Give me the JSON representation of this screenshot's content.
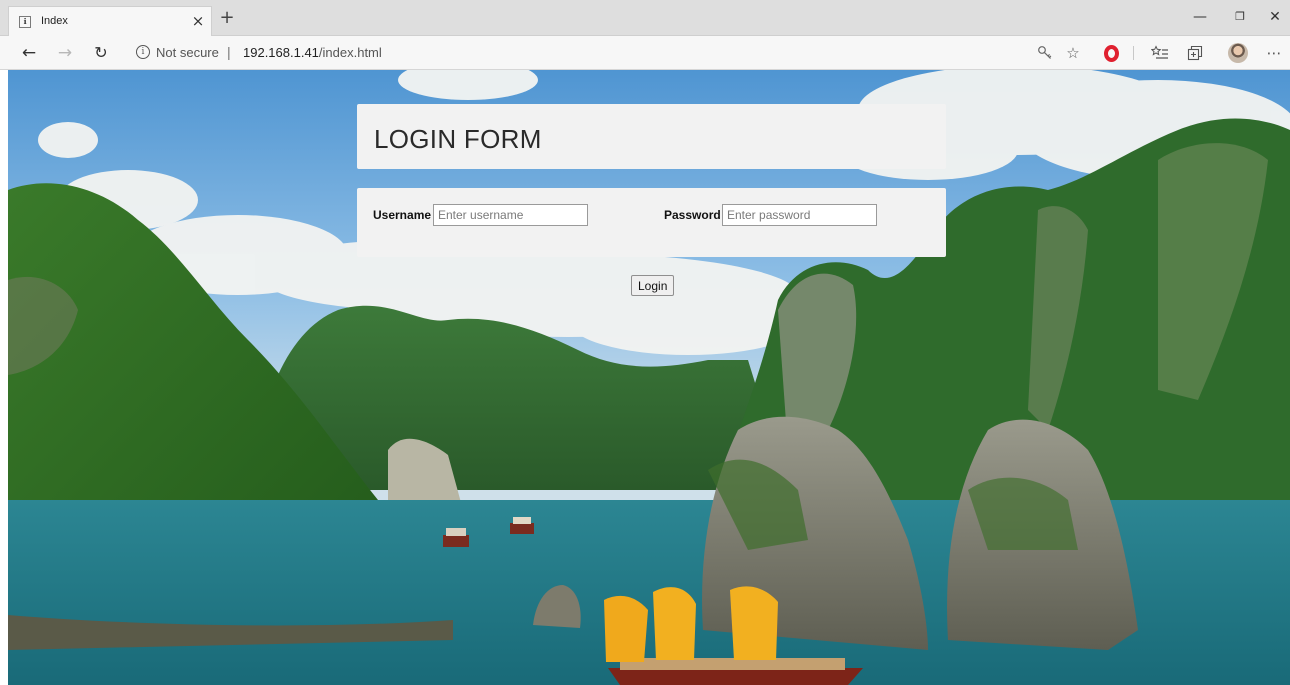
{
  "browser": {
    "tab_title": "Index",
    "tab_close_glyph": "×",
    "new_tab_glyph": "+",
    "security_label": "Not secure",
    "separator": "|",
    "url_host": "192.168.1.41",
    "url_path": "/index.html",
    "icons": [
      "back-arrow-icon",
      "forward-arrow-icon",
      "refresh-icon",
      "info-icon",
      "key-icon",
      "star-icon",
      "opera-icon",
      "favorites-icon",
      "collections-icon",
      "profile-avatar",
      "more-icon"
    ],
    "window_controls": {
      "minimize": "—",
      "maximize": "❐",
      "close": "✕"
    }
  },
  "form": {
    "title": "LOGIN FORM",
    "username_label": "Username",
    "username_placeholder": "Enter username",
    "username_value": "",
    "password_label": "Password",
    "password_placeholder": "Enter password",
    "password_value": "",
    "submit_label": "Login"
  },
  "colors": {
    "panel_bg": "#f2f2f2",
    "opera_red": "#e0202f",
    "sky": "#5e9fd6",
    "water": "#2f8a98",
    "foliage": "#2e6b24",
    "sail": "#f0a91c"
  }
}
